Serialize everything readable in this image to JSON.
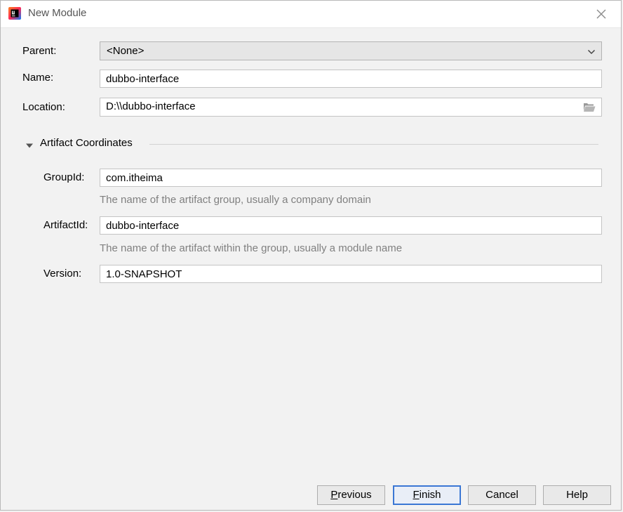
{
  "window": {
    "title": "New Module"
  },
  "form": {
    "parent_label": "Parent:",
    "parent_value": "<None>",
    "name_label": "Name:",
    "name_value": "dubbo-interface",
    "location_label": "Location:",
    "location_value": "D:\\\\dubbo-interface"
  },
  "artifact": {
    "section_title": "Artifact Coordinates",
    "groupid_label": "GroupId:",
    "groupid_value": "com.itheima",
    "groupid_hint": "The name of the artifact group, usually a company domain",
    "artifactid_label": "ArtifactId:",
    "artifactid_value": "dubbo-interface",
    "artifactid_hint": "The name of the artifact within the group, usually a module name",
    "version_label": "Version:",
    "version_value": "1.0-SNAPSHOT"
  },
  "buttons": {
    "previous_mnemonic": "P",
    "previous_rest": "revious",
    "finish_mnemonic": "F",
    "finish_rest": "inish",
    "cancel": "Cancel",
    "help": "Help"
  },
  "icons": {
    "app": "intellij-idea-icon",
    "close": "close-icon",
    "dropdown": "chevron-down-icon",
    "folder": "folder-icon",
    "section_toggle": "triangle-down-icon"
  },
  "colors": {
    "accent": "#3b77d4",
    "hint_text": "#808080",
    "background": "#f2f2f2"
  }
}
